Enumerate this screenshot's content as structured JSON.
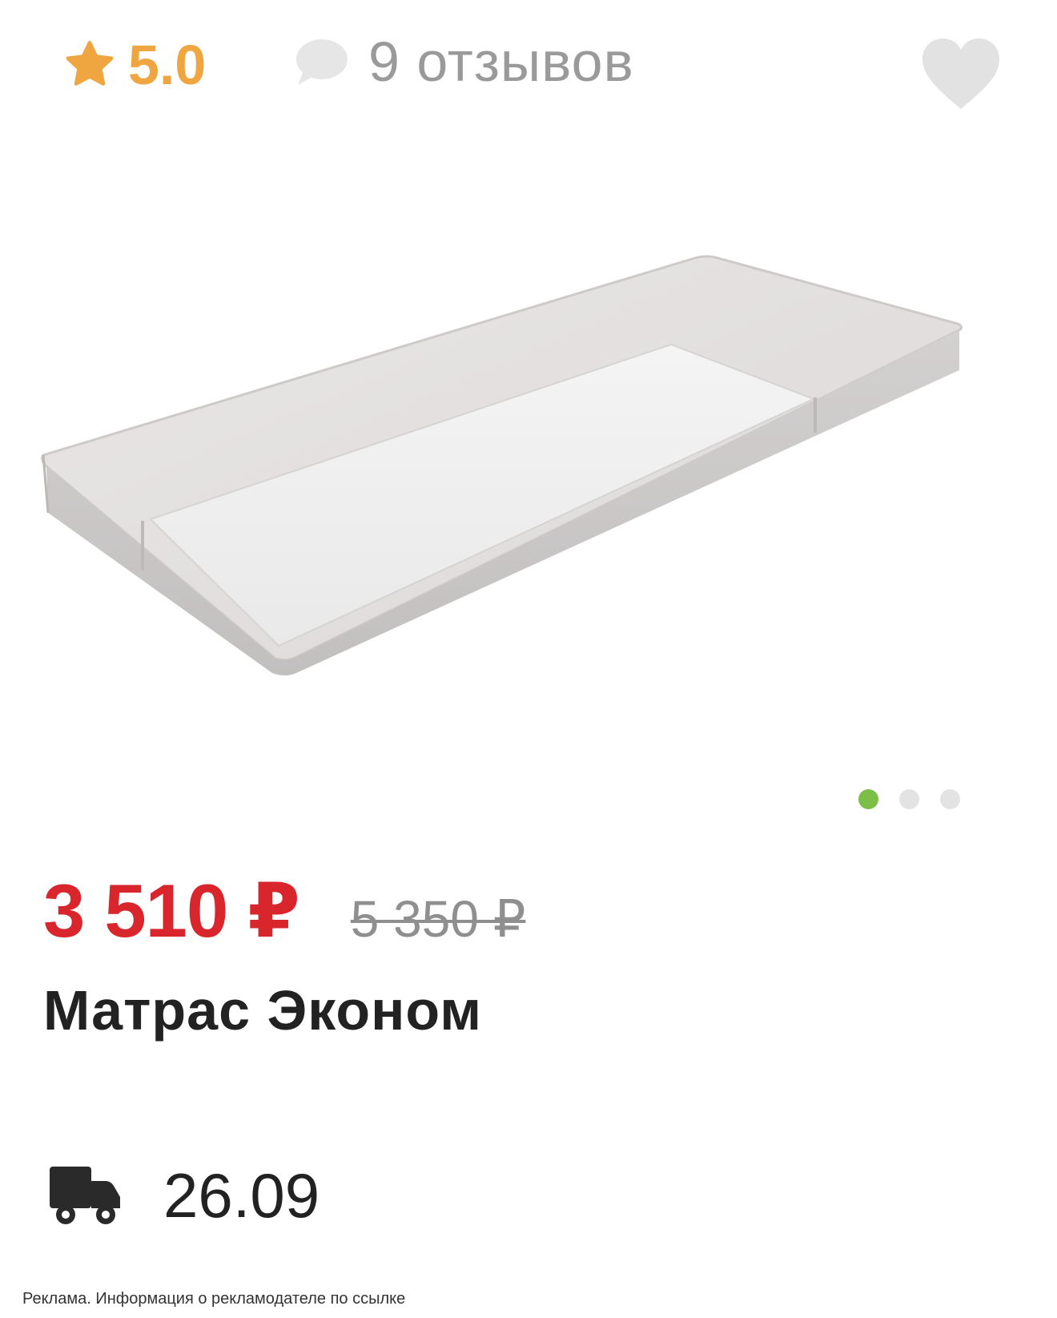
{
  "rating": {
    "value": "5.0",
    "icon": "star-icon",
    "color": "#f0a640"
  },
  "reviews": {
    "label": "9 отзывов",
    "icon": "speech-bubble-icon"
  },
  "favorite": {
    "icon": "heart-icon"
  },
  "gallery": {
    "image": "mattress-photo",
    "total_slides": 3,
    "active_slide": 1,
    "active_color": "#7cbf47"
  },
  "price": {
    "current": "3 510 ₽",
    "old": "5 350 ₽",
    "current_color": "#d9262c"
  },
  "product": {
    "title": "Матрас Эконом"
  },
  "delivery": {
    "icon": "truck-icon",
    "date": "26.09"
  },
  "ad_note": "Реклама. Информация о рекламодателе по ссылке"
}
